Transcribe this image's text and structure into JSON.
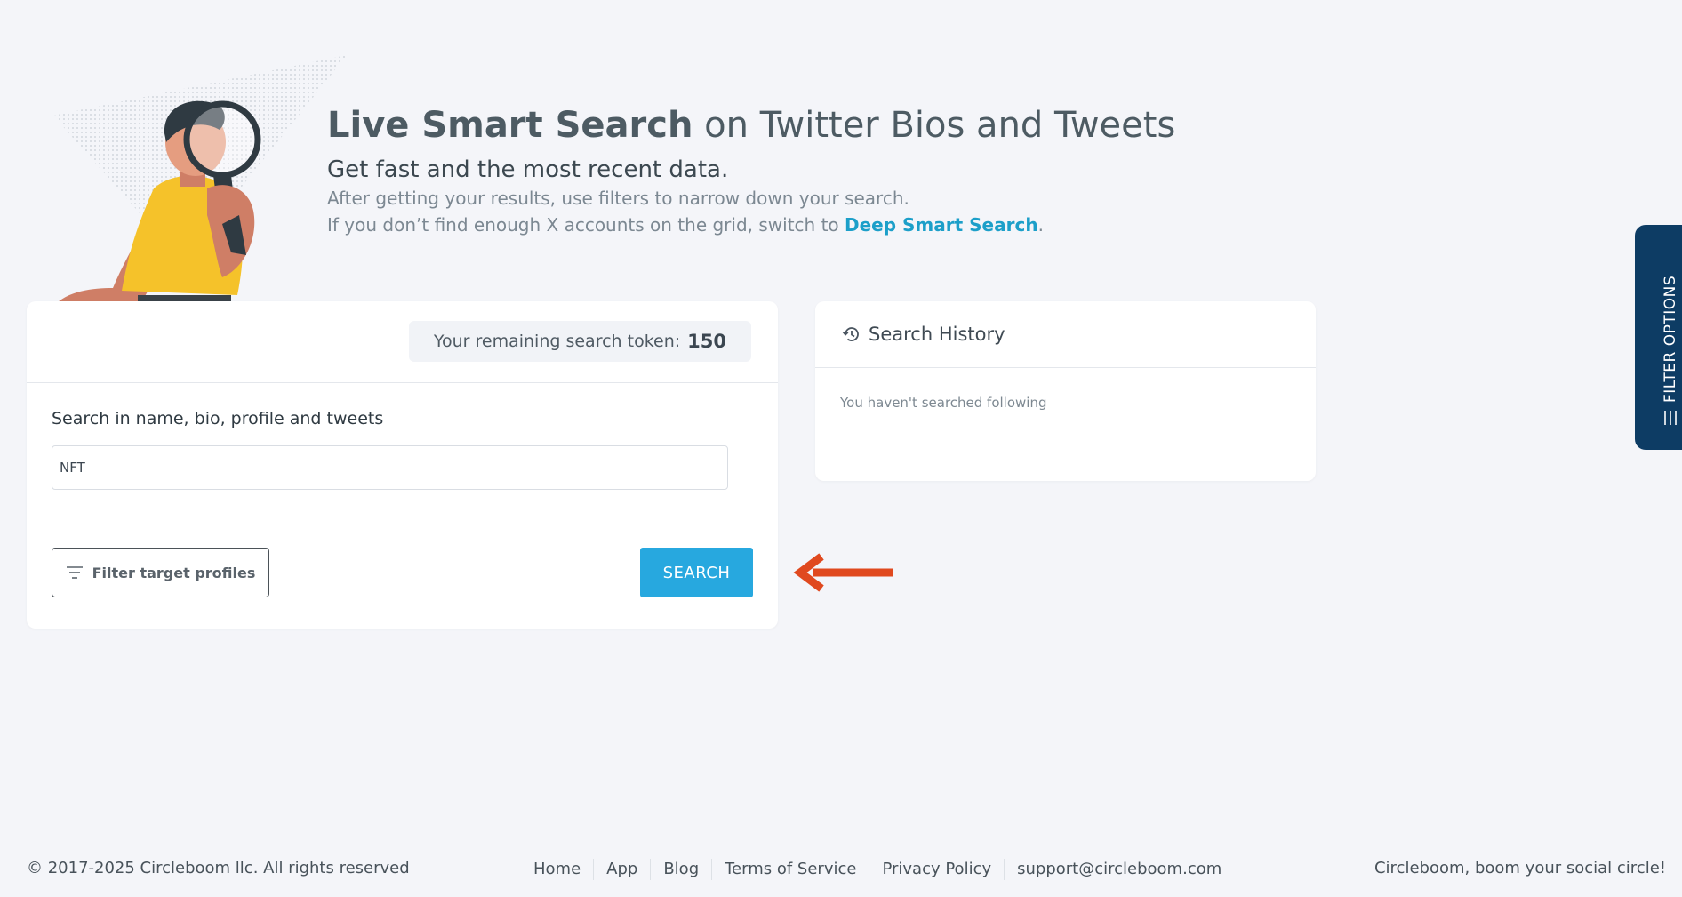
{
  "hero": {
    "title_bold": "Live Smart Search",
    "title_rest": " on Twitter Bios and Tweets",
    "subtitle": "Get fast and the most recent data.",
    "line1": "After getting your results, use filters to narrow down your search.",
    "line2_prefix": "If you don’t find enough X accounts on the grid, switch to ",
    "line2_link": "Deep Smart Search",
    "line2_suffix": "."
  },
  "search_card": {
    "token_label": "Your remaining search token:",
    "token_value": "150",
    "field_label": "Search in name, bio, profile and tweets",
    "input_value": "NFT",
    "filter_button": "Filter target profiles",
    "search_button": "SEARCH"
  },
  "history": {
    "title": "Search History",
    "empty_text": "You haven't searched following"
  },
  "side_tab": {
    "label": "FILTER OPTIONS"
  },
  "footer": {
    "copyright": "© 2017-2025 Circleboom llc. All rights reserved",
    "links": [
      "Home",
      "App",
      "Blog",
      "Terms of Service",
      "Privacy Policy",
      "support@circleboom.com"
    ],
    "tagline": "Circleboom, boom your social circle!"
  },
  "colors": {
    "accent": "#27a8df",
    "link": "#1c9fc9",
    "side_tab": "#0d3c64",
    "arrow": "#e0491f",
    "background": "#f4f5f9"
  },
  "icons": [
    "history-icon",
    "filter-icon",
    "arrow-left-icon",
    "menu-lines-icon"
  ]
}
